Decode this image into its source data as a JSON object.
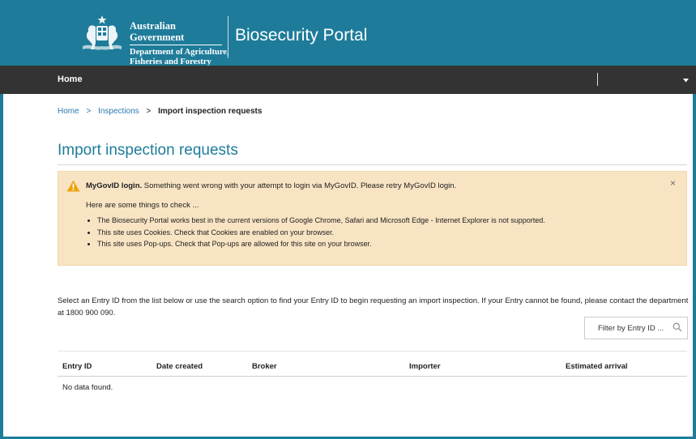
{
  "header": {
    "gov_line1": "Australian Government",
    "gov_line2": "Department of Agriculture,",
    "gov_line3": "Fisheries and Forestry",
    "portal_title": "Biosecurity Portal",
    "crest_icon": "coat-of-arms-icon"
  },
  "nav": {
    "home_label": "Home",
    "dropdown_icon": "caret-down-icon"
  },
  "breadcrumb": {
    "items": [
      "Home",
      "Inspections",
      "Import inspection requests"
    ],
    "separator": ">"
  },
  "page": {
    "title": "Import inspection requests"
  },
  "alert": {
    "title_bold": "MyGovID login.",
    "title_rest": " Something went wrong with your attempt to login via MyGovID. Please retry MyGovID login.",
    "subtitle": "Here are some things to check ...",
    "items": [
      "The Biosecurity Portal works best in the current versions of Google Chrome, Safari and Microsoft Edge - Internet Explorer is not supported.",
      "This site uses Cookies. Check that Cookies are enabled on your browser.",
      "This site uses Pop-ups. Check that Pop-ups are allowed for this site on your browser."
    ],
    "close": "×",
    "icon": "warning-triangle-icon",
    "bg_color": "#f8e4c3"
  },
  "intro": "Select an Entry ID from the list below or use the search option to find your Entry ID to begin requesting an import inspection. If your Entry cannot be found, please contact the department at 1800 900 090.",
  "filter": {
    "placeholder": "Filter by Entry ID ...",
    "icon": "search-icon"
  },
  "table": {
    "columns": [
      "Entry ID",
      "Date created",
      "Broker",
      "Importer",
      "Estimated arrival"
    ],
    "empty_message": "No data found."
  },
  "colors": {
    "brand": "#1e7c9a",
    "nav": "#333333",
    "link": "#2a78b0"
  }
}
